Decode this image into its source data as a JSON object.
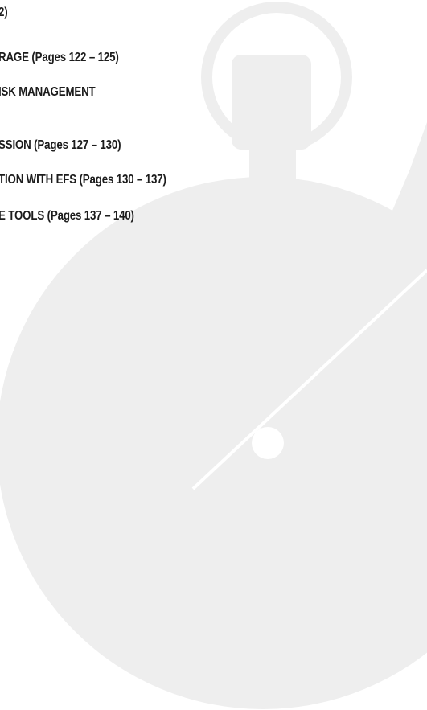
{
  "contents": {
    "lines": [
      "2)",
      "RAGE  (Pages  122 – 125)",
      "ISK MANAGEMENT",
      "SSION  (Pages  127 – 130)",
      "TION WITH EFS  (Pages  130 – 137)",
      "E TOOLS  (Pages  137 – 140)"
    ]
  },
  "watermark": {
    "icon": "stopwatch-icon",
    "color": "#eeeeee"
  }
}
